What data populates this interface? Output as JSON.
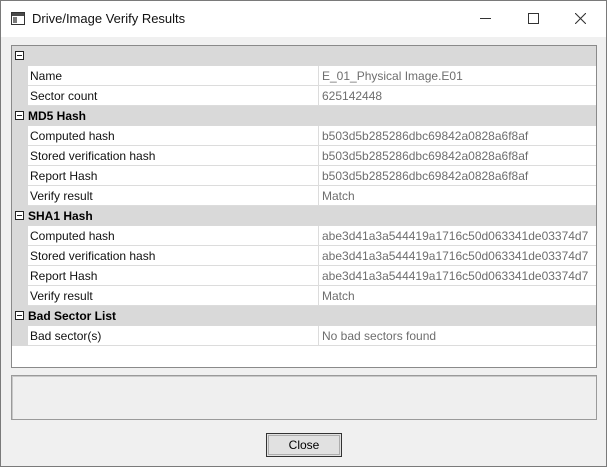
{
  "window": {
    "title": "Drive/Image Verify Results"
  },
  "grid": {
    "sections": [
      {
        "id": "root",
        "label": "",
        "rows": [
          {
            "name": "Name",
            "value": "E_01_Physical Image.E01"
          },
          {
            "name": "Sector count",
            "value": "625142448"
          }
        ]
      },
      {
        "id": "md5",
        "label": "MD5 Hash",
        "rows": [
          {
            "name": "Computed hash",
            "value": "b503d5b285286dbc69842a0828a6f8af"
          },
          {
            "name": "Stored verification hash",
            "value": "b503d5b285286dbc69842a0828a6f8af"
          },
          {
            "name": "Report Hash",
            "value": "b503d5b285286dbc69842a0828a6f8af"
          },
          {
            "name": "Verify result",
            "value": "Match"
          }
        ]
      },
      {
        "id": "sha1",
        "label": "SHA1 Hash",
        "rows": [
          {
            "name": "Computed hash",
            "value": "abe3d41a3a544419a1716c50d063341de03374d7"
          },
          {
            "name": "Stored verification hash",
            "value": "abe3d41a3a544419a1716c50d063341de03374d7"
          },
          {
            "name": "Report Hash",
            "value": "abe3d41a3a544419a1716c50d063341de03374d7"
          },
          {
            "name": "Verify result",
            "value": "Match"
          }
        ]
      },
      {
        "id": "bad-sectors",
        "label": "Bad Sector List",
        "rows": [
          {
            "name": "Bad sector(s)",
            "value": "No bad sectors found"
          }
        ]
      }
    ]
  },
  "buttons": {
    "close_label": "Close"
  },
  "icons": {
    "app": "app-window-icon",
    "minimize": "minimize-icon",
    "maximize": "maximize-icon",
    "close": "close-icon",
    "collapse": "collapse-icon"
  }
}
